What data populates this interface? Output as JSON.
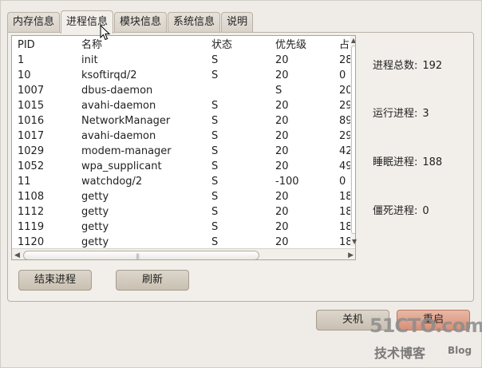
{
  "tabs": [
    {
      "label": "内存信息",
      "active": false
    },
    {
      "label": "进程信息",
      "active": true
    },
    {
      "label": "模块信息",
      "active": false
    },
    {
      "label": "系统信息",
      "active": false
    },
    {
      "label": "说明",
      "active": false
    }
  ],
  "process_table": {
    "headers": {
      "pid": "PID",
      "name": "名称",
      "state": "状态",
      "priority": "优先级",
      "cpu": "占"
    },
    "rows": [
      {
        "pid": "1",
        "name": "init",
        "state": "S",
        "priority": "20",
        "cpu": "28"
      },
      {
        "pid": "10",
        "name": "ksoftirqd/2",
        "state": "S",
        "priority": "20",
        "cpu": "0"
      },
      {
        "pid": "1007",
        "name": "dbus-daemon",
        "state": "",
        "priority": "S",
        "cpu": "20"
      },
      {
        "pid": "1015",
        "name": "avahi-daemon",
        "state": "S",
        "priority": "20",
        "cpu": "29"
      },
      {
        "pid": "1016",
        "name": "NetworkManager",
        "state": "S",
        "priority": "20",
        "cpu": "89"
      },
      {
        "pid": "1017",
        "name": "avahi-daemon",
        "state": "S",
        "priority": "20",
        "cpu": "29"
      },
      {
        "pid": "1029",
        "name": "modem-manager",
        "state": "S",
        "priority": "20",
        "cpu": "42"
      },
      {
        "pid": "1052",
        "name": "wpa_supplicant",
        "state": "S",
        "priority": "20",
        "cpu": "49"
      },
      {
        "pid": "11",
        "name": "watchdog/2",
        "state": "S",
        "priority": "-100",
        "cpu": "0"
      },
      {
        "pid": "1108",
        "name": "getty",
        "state": "S",
        "priority": "20",
        "cpu": "18"
      },
      {
        "pid": "1112",
        "name": "getty",
        "state": "S",
        "priority": "20",
        "cpu": "18"
      },
      {
        "pid": "1119",
        "name": "getty",
        "state": "S",
        "priority": "20",
        "cpu": "18"
      },
      {
        "pid": "1120",
        "name": "getty",
        "state": "S",
        "priority": "20",
        "cpu": "18"
      }
    ]
  },
  "stats": {
    "total_label": "进程总数:",
    "total_value": "192",
    "running_label": "运行进程:",
    "running_value": "3",
    "sleeping_label": "睡眠进程:",
    "sleeping_value": "188",
    "zombie_label": "僵死进程:",
    "zombie_value": "0"
  },
  "buttons": {
    "end_process": "结束进程",
    "refresh": "刷新",
    "shutdown": "关机",
    "restart": "重启"
  },
  "scrollbar": {
    "h_grip": "|||"
  },
  "watermark": {
    "site": "51CTO.com",
    "sub": "技术博客",
    "blog": "Blog"
  },
  "colors": {
    "accent_restart": "#d98f78",
    "button": "#c9c0b2",
    "watermark": "#9a9a9a"
  }
}
